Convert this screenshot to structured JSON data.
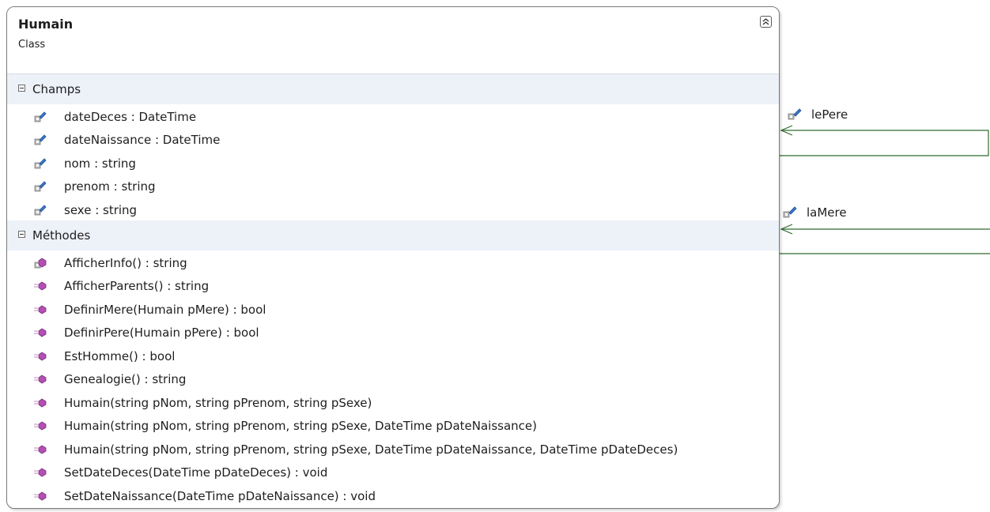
{
  "class": {
    "name": "Humain",
    "stereotype": "Class"
  },
  "sections": {
    "fields": {
      "title": "Champs",
      "items": [
        {
          "text": "dateDeces : DateTime",
          "icon": "private-field-icon"
        },
        {
          "text": "dateNaissance : DateTime",
          "icon": "private-field-icon"
        },
        {
          "text": "nom : string",
          "icon": "private-field-icon"
        },
        {
          "text": "prenom : string",
          "icon": "private-field-icon"
        },
        {
          "text": "sexe : string",
          "icon": "private-field-icon"
        }
      ]
    },
    "methods": {
      "title": "Méthodes",
      "items": [
        {
          "text": "AfficherInfo() : string",
          "icon": "private-method-icon"
        },
        {
          "text": "AfficherParents() : string",
          "icon": "public-method-icon"
        },
        {
          "text": "DefinirMere(Humain pMere) : bool",
          "icon": "public-method-icon"
        },
        {
          "text": "DefinirPere(Humain pPere) : bool",
          "icon": "public-method-icon"
        },
        {
          "text": "EstHomme() : bool",
          "icon": "public-method-icon"
        },
        {
          "text": "Genealogie() : string",
          "icon": "public-method-icon"
        },
        {
          "text": "Humain(string pNom, string pPrenom, string pSexe)",
          "icon": "public-method-icon"
        },
        {
          "text": "Humain(string pNom, string pPrenom, string pSexe, DateTime pDateNaissance)",
          "icon": "public-method-icon"
        },
        {
          "text": "Humain(string pNom, string pPrenom, string pSexe, DateTime pDateNaissance, DateTime pDateDeces)",
          "icon": "public-method-icon"
        },
        {
          "text": "SetDateDeces(DateTime pDateDeces) : void",
          "icon": "public-method-icon"
        },
        {
          "text": "SetDateNaissance(DateTime pDateNaissance) : void",
          "icon": "public-method-icon"
        }
      ]
    }
  },
  "associations": [
    {
      "label": "lePere",
      "icon": "private-field-icon"
    },
    {
      "label": "laMere",
      "icon": "private-field-icon"
    }
  ],
  "colors": {
    "association_line": "#2e6b2e",
    "section_background": "#edf1f8",
    "method_icon": "#b44fb4",
    "field_icon": "#3b78c9"
  }
}
